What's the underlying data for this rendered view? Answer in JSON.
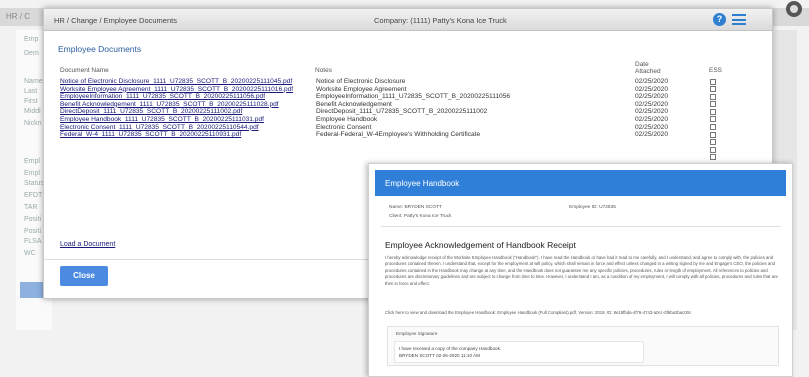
{
  "background": {
    "topbar_text": "HR / C",
    "panel_items": [
      "Emp",
      "Dem",
      "Name",
      "Last",
      "First",
      "Middl",
      "Nickn",
      "Empl",
      "Empl",
      "Status",
      "EFDT",
      "TAR",
      "Positi",
      "Positi",
      "FLSA",
      "WC"
    ]
  },
  "modal": {
    "breadcrumb": "HR / Change / Employee Documents",
    "company": "Company: (1111) Patty's Kona Ice Truck",
    "section_title": "Employee Documents",
    "columns": {
      "name": "Document Name",
      "notes": "Notes",
      "date": "Date\nAttached",
      "ess": "ESS"
    },
    "rows": [
      {
        "name": "Notice of Electronic Disclosure_1111_U72835_SCOTT_B_20200225111045.pdf",
        "notes": "Notice of Electronic Disclosure",
        "date": "02/25/2020"
      },
      {
        "name": "Worksite Employee Agreement_1111_U72835_SCOTT_B_20200225111016.pdf",
        "notes": "Worksite Employee Agreement",
        "date": "02/25/2020"
      },
      {
        "name": "EmployeeInformation_1111_U72835_SCOTT_B_20200225111056.pdf",
        "notes": "EmployeeInformation_1111_U72835_SCOTT_B_20200225111056",
        "date": "02/25/2020"
      },
      {
        "name": "Benefit Acknowledgement_1111_U72835_SCOTT_B_20200225111028.pdf",
        "notes": "Benefit Acknowledgement",
        "date": "02/25/2020"
      },
      {
        "name": "DirectDeposit_1111_U72835_SCOTT_B_20200225111002.pdf",
        "notes": "DirectDeposit_1111_U72835_SCOTT_B_20200225111002",
        "date": "02/25/2020"
      },
      {
        "name": "Employee Handbook_1111_U72835_SCOTT_B_20200225111031.pdf",
        "notes": "Employee Handbook",
        "date": "02/25/2020"
      },
      {
        "name": "Electronic Consent_1111_U72835_SCOTT_B_20200225110544.pdf",
        "notes": "Electronic Consent",
        "date": "02/25/2020"
      },
      {
        "name": "Federal_W-4_1111_U72835_SCOTT_B_20200225110931.pdf",
        "notes": "Federal-Federal_W-4Employee's Withholding Certificate",
        "date": "02/25/2020"
      },
      {
        "name": "",
        "notes": "",
        "date": ""
      },
      {
        "name": "",
        "notes": "",
        "date": ""
      },
      {
        "name": "",
        "notes": "",
        "date": ""
      }
    ],
    "upload_link": "Load a Document",
    "close_label": "Close"
  },
  "handbook": {
    "header": "Employee Handbook",
    "name_line": "Name:  BRYDEN SCOTT",
    "employee_id": "Employee ID:  U72835",
    "client_line": "Client:  Patty's Kona Ice Truck",
    "title": "Employee Acknowledgement of Handbook Receipt",
    "body": "I hereby acknowledge receipt of the Worksite Employee Handbook (\"Handbook\"). I have read the Handbook or have had it read to me carefully, and I understand, and agree to comply with, the policies and procedures contained therein. I understand that, except for the employment at will policy, which shall remain in force and effect unless changed in a writing signed by me and Engage's CEO, the policies and procedures contained in the Handbook may change at any time, and the Handbook does not guarantee me any specific policies, procedures, rules or length of employment. All references to policies and procedures are discretionary guidelines and are subject to change from time to time. However, I understand I am, as a condition of my employment, I will comply with all policies, procedures and rules that are then in force and effect.",
    "link_text": "Click here to view and download the Employee Handbook: Employee Handbook (Full Compliant).pdf, Version: 2019, ID: 8e18fbda-4f76-4743-a0cc-0f6ba2bac00c",
    "sig_title": "Employee Signature",
    "sig_line1": "I have received a copy of the company Handbook.",
    "sig_line2": "BRYDEN SCOTT 02-25-2020 11:10 AM"
  }
}
